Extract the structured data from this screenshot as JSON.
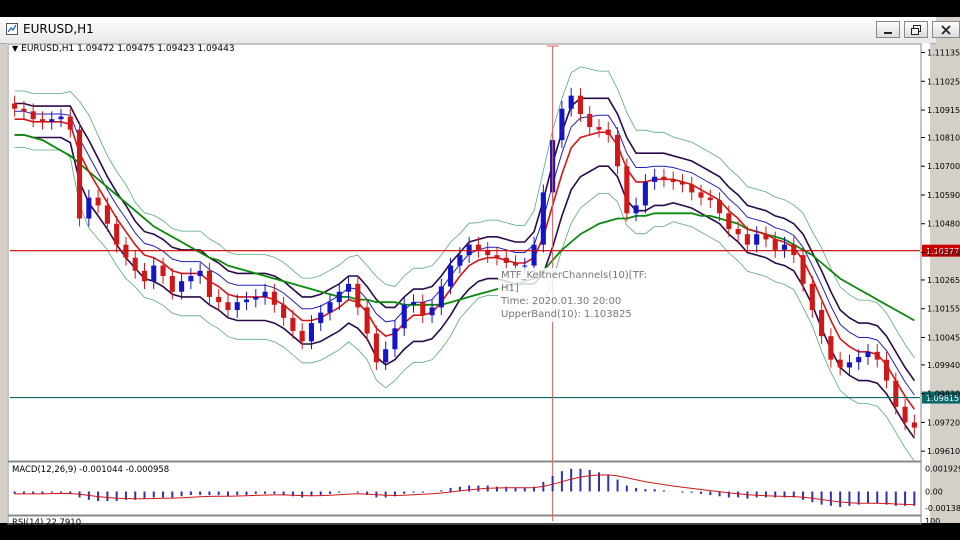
{
  "window": {
    "title": "EURUSD,H1"
  },
  "symbol_line": {
    "arrow": "▼",
    "text": "EURUSD,H1  1.09472 1.09475 1.09423 1.09443"
  },
  "tooltip": {
    "line1": "MTF_KeltnerChannels(10)[TF:",
    "line2": "H1]",
    "line3": "Time: 2020.01.30 20:00",
    "line4": "UpperBand(10): 1.103825"
  },
  "macd": {
    "label": "MACD(12,26,9) -0.001044 -0.000958"
  },
  "rsi": {
    "label": "RSI(14) 22.7910"
  },
  "icons": {
    "minimize": "minimize-icon",
    "restore": "restore-icon",
    "close": "close-icon"
  },
  "colors": {
    "bull_candle": "#1414c8",
    "bear_candle": "#d01818",
    "ma_fast": "#d41616",
    "ma_slow": "#0a8a0a",
    "keltner": "#2a0a4a",
    "bollinger": "#5aaa7a",
    "hline_red": "#cc0000",
    "hline_teal": "#0a6a6a",
    "crosshair": "#e06060"
  },
  "chart_data": {
    "type": "line",
    "title": "EURUSD,H1",
    "price_axis": {
      "ylim": [
        1.0958,
        1.1116
      ],
      "ticks": [
        "1.11135",
        "1.11025",
        "1.10915",
        "1.10810",
        "1.10700",
        "1.10590",
        "1.10480",
        "1.10370",
        "1.10265",
        "1.10155",
        "1.10045",
        "1.09940",
        "1.09830",
        "1.09720",
        "1.09610"
      ]
    },
    "price_markers": [
      {
        "label": "1.10377",
        "value": 1.10377,
        "color": "#cc0000"
      },
      {
        "label": "1.09815",
        "value": 1.09815,
        "color": "#0a6a6a"
      }
    ],
    "series": [
      {
        "name": "EURUSD,H1 Close",
        "values": [
          1.1092,
          1.1091,
          1.1088,
          1.1087,
          1.1088,
          1.1089,
          1.1084,
          1.105,
          1.1058,
          1.1055,
          1.1048,
          1.104,
          1.1035,
          1.103,
          1.1026,
          1.1032,
          1.1028,
          1.1022,
          1.1026,
          1.1028,
          1.103,
          1.102,
          1.1018,
          1.1015,
          1.1018,
          1.1019,
          1.102,
          1.1022,
          1.1017,
          1.1012,
          1.1007,
          1.1003,
          1.101,
          1.1014,
          1.1018,
          1.1022,
          1.1025,
          1.1016,
          1.1006,
          1.0995,
          1.1,
          1.1008,
          1.1017,
          1.1018,
          1.1013,
          1.1016,
          1.1024,
          1.1032,
          1.1036,
          1.104,
          1.1038,
          1.1036,
          1.1035,
          1.1033,
          1.1032,
          1.1032,
          1.104,
          1.106,
          1.108,
          1.1092,
          1.1097,
          1.109,
          1.1085,
          1.1084,
          1.1082,
          1.107,
          1.1052,
          1.1055,
          1.1064,
          1.1066,
          1.1065,
          1.1064,
          1.1063,
          1.106,
          1.1058,
          1.1057,
          1.1052,
          1.1046,
          1.1044,
          1.104,
          1.1044,
          1.1042,
          1.1038,
          1.104,
          1.1036,
          1.1025,
          1.1015,
          1.1005,
          1.0996,
          1.0993,
          1.0995,
          1.0997,
          1.0999,
          1.0996,
          1.0988,
          1.0978,
          1.0972,
          1.097
        ]
      },
      {
        "name": "MA fast",
        "values": [
          1.1088,
          1.1088,
          1.1087,
          1.1087,
          1.1087,
          1.1087,
          1.1086,
          1.1075,
          1.1068,
          1.1062,
          1.1056,
          1.105,
          1.1045,
          1.104,
          1.1036,
          1.1035,
          1.1033,
          1.103,
          1.1029,
          1.1029,
          1.1029,
          1.1026,
          1.1024,
          1.1021,
          1.102,
          1.102,
          1.102,
          1.102,
          1.1019,
          1.1017,
          1.1014,
          1.1011,
          1.1011,
          1.1012,
          1.1014,
          1.1016,
          1.1019,
          1.1018,
          1.1014,
          1.1008,
          1.1005,
          1.1006,
          1.101,
          1.1013,
          1.1013,
          1.1014,
          1.1018,
          1.1023,
          1.1028,
          1.1032,
          1.1034,
          1.1035,
          1.1035,
          1.1034,
          1.1033,
          1.1033,
          1.1035,
          1.1043,
          1.1055,
          1.1067,
          1.1077,
          1.1081,
          1.1082,
          1.1083,
          1.1083,
          1.1078,
          1.1069,
          1.1064,
          1.1064,
          1.1065,
          1.1065,
          1.1065,
          1.1064,
          1.1063,
          1.1061,
          1.1059,
          1.1057,
          1.1053,
          1.105,
          1.1046,
          1.1045,
          1.1044,
          1.1042,
          1.1041,
          1.1039,
          1.1034,
          1.1027,
          1.1019,
          1.1011,
          1.1004,
          1.1001,
          1.0999,
          1.0999,
          1.0998,
          1.0994,
          1.0988,
          1.0982,
          1.0977
        ]
      },
      {
        "name": "MA slow",
        "values": [
          1.1082,
          1.1082,
          1.1081,
          1.108,
          1.1078,
          1.1076,
          1.1074,
          1.1071,
          1.1068,
          1.1065,
          1.1062,
          1.1059,
          1.1056,
          1.1053,
          1.105,
          1.1047,
          1.1045,
          1.1043,
          1.1041,
          1.1039,
          1.1037,
          1.1035,
          1.1034,
          1.1032,
          1.1031,
          1.103,
          1.1029,
          1.1028,
          1.1027,
          1.1026,
          1.1025,
          1.1024,
          1.1023,
          1.1022,
          1.1021,
          1.102,
          1.102,
          1.1019,
          1.1019,
          1.1018,
          1.1018,
          1.1018,
          1.1017,
          1.1017,
          1.1017,
          1.1017,
          1.1017,
          1.1018,
          1.1019,
          1.102,
          1.1021,
          1.1022,
          1.1023,
          1.1024,
          1.1025,
          1.1026,
          1.1027,
          1.103,
          1.1034,
          1.1038,
          1.1041,
          1.1044,
          1.1046,
          1.1048,
          1.1049,
          1.105,
          1.105,
          1.1051,
          1.1051,
          1.1052,
          1.1052,
          1.1052,
          1.1052,
          1.1052,
          1.1051,
          1.1051,
          1.105,
          1.1049,
          1.1048,
          1.1046,
          1.1045,
          1.1044,
          1.1043,
          1.1042,
          1.104,
          1.1038,
          1.1036,
          1.1033,
          1.103,
          1.1027,
          1.1025,
          1.1023,
          1.1021,
          1.1019,
          1.1017,
          1.1015,
          1.1013,
          1.1011
        ]
      }
    ],
    "band_width_upper": [
      0.0006,
      0.0006,
      0.0006,
      0.0006,
      0.0006,
      0.0006,
      0.0007,
      0.0011,
      0.0012,
      0.0011,
      0.001,
      0.001,
      0.001,
      0.0009,
      0.0009,
      0.0009,
      0.0009,
      0.0009,
      0.0009,
      0.0009,
      0.0009,
      0.0009,
      0.0009,
      0.0009,
      0.0009,
      0.0009,
      0.0009,
      0.0009,
      0.0009,
      0.0009,
      0.0009,
      0.0009,
      0.0009,
      0.0009,
      0.0009,
      0.0009,
      0.0009,
      0.001,
      0.001,
      0.0011,
      0.0011,
      0.001,
      0.001,
      0.001,
      0.001,
      0.001,
      0.001,
      0.001,
      0.0009,
      0.0009,
      0.0008,
      0.0008,
      0.0008,
      0.0008,
      0.0008,
      0.0008,
      0.001,
      0.0014,
      0.0016,
      0.0016,
      0.0016,
      0.0015,
      0.0014,
      0.0013,
      0.0013,
      0.0012,
      0.0012,
      0.0011,
      0.0011,
      0.001,
      0.001,
      0.0009,
      0.0009,
      0.0009,
      0.0009,
      0.0009,
      0.0009,
      0.0009,
      0.0009,
      0.0009,
      0.0009,
      0.0009,
      0.0009,
      0.0009,
      0.0009,
      0.001,
      0.001,
      0.0011,
      0.0011,
      0.0011,
      0.0011,
      0.0011,
      0.0011,
      0.0011,
      0.0011,
      0.0011,
      0.0011,
      0.0011
    ],
    "macd_axis": {
      "ticks": [
        "0.001929",
        "0.00",
        "-0.001389"
      ],
      "ylim": [
        -0.0018,
        0.0023
      ]
    },
    "macd_histogram": [
      -0.0002,
      -0.0002,
      -0.0002,
      -0.0002,
      -0.0001,
      -0.0001,
      -0.0002,
      -0.0005,
      -0.0007,
      -0.0008,
      -0.0008,
      -0.0008,
      -0.0007,
      -0.0007,
      -0.0006,
      -0.0005,
      -0.0005,
      -0.0005,
      -0.0004,
      -0.0003,
      -0.0003,
      -0.0003,
      -0.0003,
      -0.0004,
      -0.0003,
      -0.0003,
      -0.0002,
      -0.0002,
      -0.0002,
      -0.0003,
      -0.0004,
      -0.0005,
      -0.0004,
      -0.0003,
      -0.0002,
      -0.0001,
      0.0,
      -0.0001,
      -0.0003,
      -0.0005,
      -0.0005,
      -0.0004,
      -0.0002,
      -0.0001,
      -0.0001,
      0.0,
      0.0001,
      0.0003,
      0.0004,
      0.0005,
      0.0005,
      0.0005,
      0.0004,
      0.0004,
      0.0003,
      0.0003,
      0.0004,
      0.0008,
      0.0013,
      0.0017,
      0.0019,
      0.0019,
      0.0018,
      0.0016,
      0.0014,
      0.001,
      0.0005,
      0.0003,
      0.0002,
      0.0002,
      0.0001,
      0.0,
      -0.0001,
      -0.0001,
      -0.0002,
      -0.0003,
      -0.0004,
      -0.0005,
      -0.0005,
      -0.0006,
      -0.0005,
      -0.0005,
      -0.0005,
      -0.0005,
      -0.0005,
      -0.0007,
      -0.0009,
      -0.0011,
      -0.0012,
      -0.0013,
      -0.0012,
      -0.0011,
      -0.001,
      -0.001,
      -0.0011,
      -0.0012,
      -0.0012,
      -0.0012
    ],
    "xlabel": "",
    "ylabel": "",
    "grid": false
  }
}
